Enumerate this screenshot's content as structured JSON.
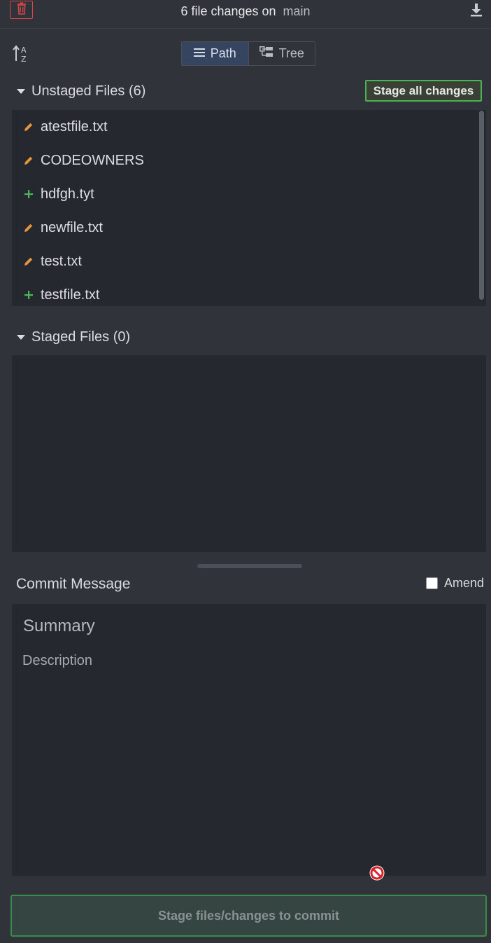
{
  "header": {
    "title": "6 file changes on",
    "branch": "main",
    "discard_icon": "trash-icon",
    "download_icon": "download-icon"
  },
  "toolbar": {
    "sort_icon": "sort-alpha-icon",
    "views": [
      {
        "label": "Path",
        "icon": "list-icon",
        "active": true
      },
      {
        "label": "Tree",
        "icon": "tree-icon",
        "active": false
      }
    ]
  },
  "unstaged": {
    "title": "Unstaged Files (6)",
    "stage_all_label": "Stage all changes",
    "files": [
      {
        "name": "atestfile.txt",
        "status": "modified"
      },
      {
        "name": "CODEOWNERS",
        "status": "modified"
      },
      {
        "name": "hdfgh.tyt",
        "status": "added"
      },
      {
        "name": "newfile.txt",
        "status": "modified"
      },
      {
        "name": "test.txt",
        "status": "modified"
      },
      {
        "name": "testfile.txt",
        "status": "added"
      }
    ]
  },
  "staged": {
    "title": "Staged Files (0)"
  },
  "commit": {
    "label": "Commit Message",
    "amend_label": "Amend",
    "amend_checked": false,
    "summary_placeholder": "Summary",
    "description_placeholder": "Description",
    "button_label": "Stage files/changes to commit"
  },
  "colors": {
    "modified": "#e8963a",
    "added": "#4cb858",
    "accent_green": "#4bb356",
    "danger": "#d9474b"
  }
}
